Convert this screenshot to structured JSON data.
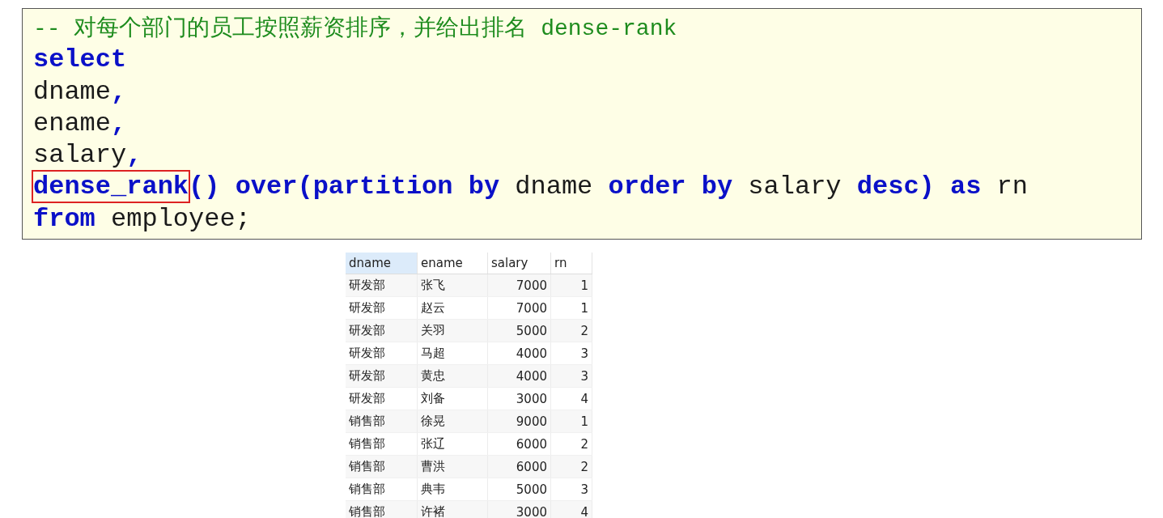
{
  "code_lines": [
    [
      {
        "kind": "comment",
        "text": "-- 对每个部门的员工按照薪资排序，并给出排名 dense-rank",
        "highlighted": false
      }
    ],
    [
      {
        "kind": "keyword",
        "text": "select",
        "highlighted": false
      }
    ],
    [
      {
        "kind": "identifier",
        "text": "dname",
        "highlighted": false
      },
      {
        "kind": "keyword",
        "text": ",",
        "highlighted": false
      }
    ],
    [
      {
        "kind": "identifier",
        "text": "ename",
        "highlighted": false
      },
      {
        "kind": "keyword",
        "text": ",",
        "highlighted": false
      }
    ],
    [
      {
        "kind": "identifier",
        "text": "salary",
        "highlighted": false
      },
      {
        "kind": "keyword",
        "text": ",",
        "highlighted": false
      }
    ],
    [
      {
        "kind": "keyword",
        "text": "dense_rank",
        "highlighted": true
      },
      {
        "kind": "keyword",
        "text": "() over(partition by",
        "highlighted": false
      },
      {
        "kind": "identifier",
        "text": " dname ",
        "highlighted": false
      },
      {
        "kind": "keyword",
        "text": "order by",
        "highlighted": false
      },
      {
        "kind": "identifier",
        "text": " salary ",
        "highlighted": false
      },
      {
        "kind": "keyword",
        "text": "desc) as",
        "highlighted": false
      },
      {
        "kind": "identifier",
        "text": " rn",
        "highlighted": false
      }
    ],
    [
      {
        "kind": "keyword",
        "text": "from",
        "highlighted": false
      },
      {
        "kind": "identifier",
        "text": " employee;",
        "highlighted": false
      }
    ]
  ],
  "table": {
    "columns": [
      {
        "label": "dname",
        "selected": true
      },
      {
        "label": "ename",
        "selected": false
      },
      {
        "label": "salary",
        "selected": false
      },
      {
        "label": "rn",
        "selected": false
      }
    ],
    "rows": [
      [
        "研发部",
        "张飞",
        "7000",
        "1"
      ],
      [
        "研发部",
        "赵云",
        "7000",
        "1"
      ],
      [
        "研发部",
        "关羽",
        "5000",
        "2"
      ],
      [
        "研发部",
        "马超",
        "4000",
        "3"
      ],
      [
        "研发部",
        "黄忠",
        "4000",
        "3"
      ],
      [
        "研发部",
        "刘备",
        "3000",
        "4"
      ],
      [
        "销售部",
        "徐晃",
        "9000",
        "1"
      ],
      [
        "销售部",
        "张辽",
        "6000",
        "2"
      ],
      [
        "销售部",
        "曹洪",
        "6000",
        "2"
      ],
      [
        "销售部",
        "典韦",
        "5000",
        "3"
      ],
      [
        "销售部",
        "许褚",
        "3000",
        "4"
      ]
    ]
  }
}
